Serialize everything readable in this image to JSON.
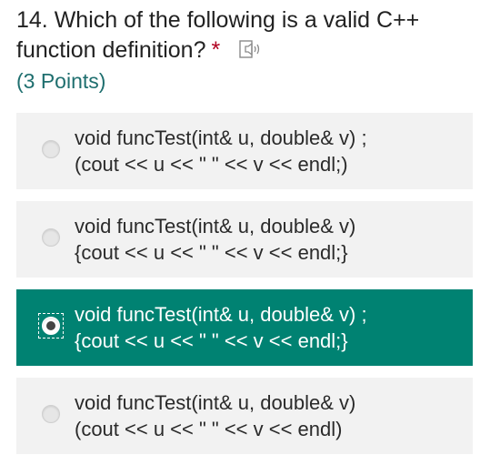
{
  "question": {
    "line1": "14. Which of the following is a valid C++",
    "line2": "function definition?",
    "required_mark": "*",
    "points": "(3 Points)",
    "speaker_icon": "speaker-icon"
  },
  "options": [
    {
      "line1": "void funcTest(int& u, double& v) ;",
      "line2": "(cout << u << \" \" << v << endl;)",
      "selected": false
    },
    {
      "line1": "void funcTest(int& u, double& v)",
      "line2": "{cout << u << \" \" << v << endl;}",
      "selected": false
    },
    {
      "line1": "void funcTest(int& u, double& v) ;",
      "line2": "{cout << u << \" \" << v << endl;}",
      "selected": true
    },
    {
      "line1": "void funcTest(int& u, double& v)",
      "line2": "(cout << u << \" \" << v << endl)",
      "selected": false
    }
  ],
  "colors": {
    "selected_bg": "#008272",
    "option_bg": "#f2f2f2",
    "required": "#b00020",
    "points": "#1f6f6f"
  }
}
